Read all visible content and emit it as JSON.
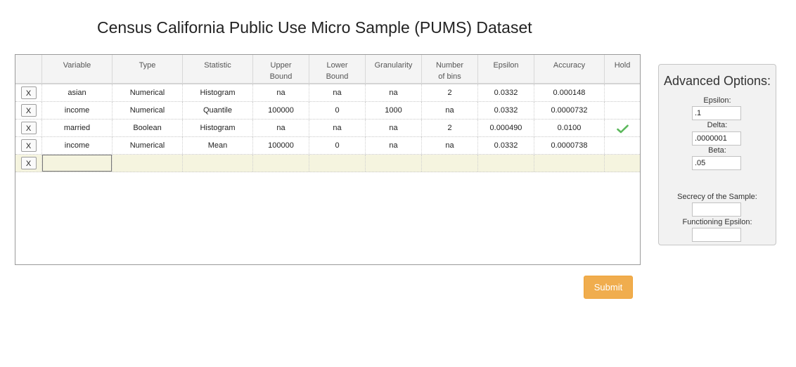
{
  "page_title": "Census California Public Use Micro Sample (PUMS) Dataset",
  "table": {
    "headers": [
      {
        "line1": "",
        "line2": ""
      },
      {
        "line1": "Variable",
        "line2": ""
      },
      {
        "line1": "Type",
        "line2": ""
      },
      {
        "line1": "Statistic",
        "line2": ""
      },
      {
        "line1": "Upper",
        "line2": "Bound"
      },
      {
        "line1": "Lower",
        "line2": "Bound"
      },
      {
        "line1": "Granularity",
        "line2": ""
      },
      {
        "line1": "Number",
        "line2": "of bins"
      },
      {
        "line1": "Epsilon",
        "line2": ""
      },
      {
        "line1": "Accuracy",
        "line2": ""
      },
      {
        "line1": "Hold",
        "line2": ""
      }
    ],
    "rows": [
      {
        "delete": "X",
        "variable": "asian",
        "type": "Numerical",
        "statistic": "Histogram",
        "upper": "na",
        "lower": "na",
        "granularity": "na",
        "bins": "2",
        "epsilon": "0.0332",
        "accuracy": "0.000148",
        "hold": ""
      },
      {
        "delete": "X",
        "variable": "income",
        "type": "Numerical",
        "statistic": "Quantile",
        "upper": "100000",
        "lower": "0",
        "granularity": "1000",
        "bins": "na",
        "epsilon": "0.0332",
        "accuracy": "0.0000732",
        "hold": ""
      },
      {
        "delete": "X",
        "variable": "married",
        "type": "Boolean",
        "statistic": "Histogram",
        "upper": "na",
        "lower": "na",
        "granularity": "na",
        "bins": "2",
        "epsilon": "0.000490",
        "accuracy": "0.0100",
        "hold": "check-icon"
      },
      {
        "delete": "X",
        "variable": "income",
        "type": "Numerical",
        "statistic": "Mean",
        "upper": "100000",
        "lower": "0",
        "granularity": "na",
        "bins": "na",
        "epsilon": "0.0332",
        "accuracy": "0.0000738",
        "hold": ""
      }
    ],
    "new_row": {
      "delete": "X",
      "variable": ""
    },
    "hold_check_color": "#5cb85c"
  },
  "submit_label": "Submit",
  "submit_color": "#f0ad4e",
  "advanced": {
    "title": "Advanced Options:",
    "epsilon_label": "Epsilon:",
    "epsilon_value": ".1",
    "delta_label": "Delta:",
    "delta_value": ".0000001",
    "beta_label": "Beta:",
    "beta_value": ".05",
    "secrecy_label": "Secrecy of the Sample:",
    "secrecy_value": "",
    "functioning_label": "Functioning Epsilon:",
    "functioning_value": ""
  }
}
